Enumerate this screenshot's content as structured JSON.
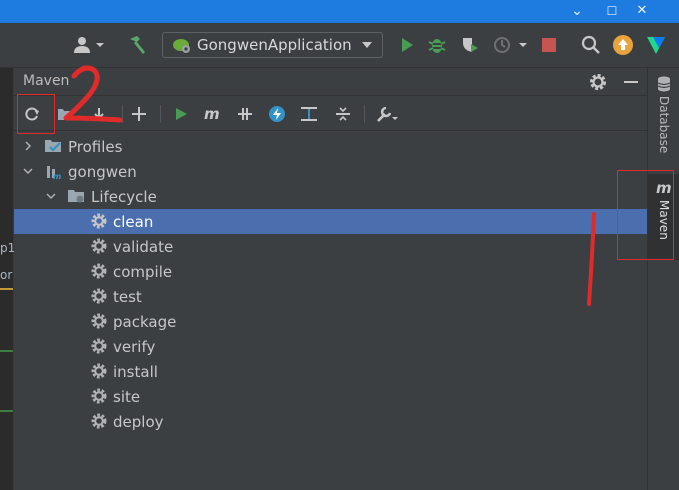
{
  "window": {
    "minimize_glyph": "⌄",
    "restore_glyph": "☐",
    "close_glyph": "✕"
  },
  "toolbar": {
    "run_config": "GongwenApplication"
  },
  "editor": {
    "fragments": [
      "p1",
      "or"
    ]
  },
  "panel": {
    "title": "Maven"
  },
  "tree": {
    "profiles": "Profiles",
    "project": "gongwen",
    "lifecycle": "Lifecycle",
    "phases": [
      "clean",
      "validate",
      "compile",
      "test",
      "package",
      "verify",
      "install",
      "site",
      "deploy"
    ],
    "selected": "clean"
  },
  "sidebar": {
    "database": "Database",
    "maven": "Maven"
  },
  "annotations": {
    "mark_1": "1",
    "mark_2": "2"
  },
  "colors": {
    "selection": "#4b6eaf",
    "run_green": "#499c54",
    "stop_red": "#c75450",
    "annotation_red": "#e02b2b",
    "titlebar_blue": "#1e7be0"
  }
}
